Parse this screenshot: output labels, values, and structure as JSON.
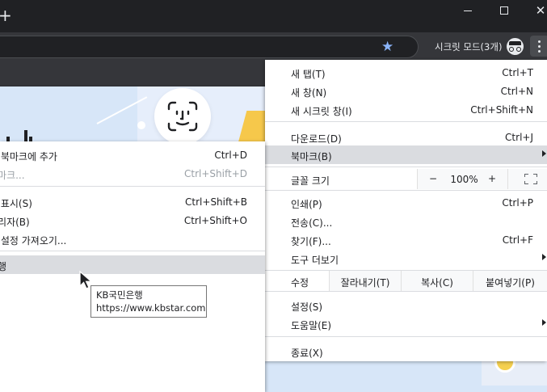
{
  "window": {
    "new_tab": "+",
    "min": "—",
    "max": "☐",
    "close": "✕"
  },
  "toolbar": {
    "incognito_label": "시크릿 모드(3개)",
    "star": "★"
  },
  "menu": {
    "items": [
      {
        "label": "새 탭(T)",
        "shortcut": "Ctrl+T"
      },
      {
        "label": "새 창(N)",
        "shortcut": "Ctrl+N"
      },
      {
        "label": "새 시크릿 창(I)",
        "shortcut": "Ctrl+Shift+N"
      },
      {
        "label": "다운로드(D)",
        "shortcut": "Ctrl+J"
      },
      {
        "label": "북마크(B)",
        "shortcut": ""
      },
      {
        "label": "인쇄(P)",
        "shortcut": "Ctrl+P"
      },
      {
        "label": "전송(C)...",
        "shortcut": ""
      },
      {
        "label": "찾기(F)...",
        "shortcut": "Ctrl+F"
      },
      {
        "label": "도구 더보기",
        "shortcut": ""
      },
      {
        "label": "설정(S)",
        "shortcut": ""
      },
      {
        "label": "도움말(E)",
        "shortcut": ""
      },
      {
        "label": "종료(X)",
        "shortcut": ""
      }
    ],
    "zoom": {
      "label": "글꼴 크기",
      "minus": "−",
      "value": "100%",
      "plus": "+"
    },
    "edit": {
      "label": "수정",
      "cut": "잘라내기(T)",
      "copy": "복사(C)",
      "paste": "붙여넣기(P)"
    }
  },
  "bookmark_submenu": {
    "items": [
      {
        "label": "을 북마크에 추가",
        "shortcut": "Ctrl+D"
      },
      {
        "label": "북마크...",
        "shortcut": "Ctrl+Shift+D"
      },
      {
        "label": "바 표시(S)",
        "shortcut": "Ctrl+Shift+B"
      },
      {
        "label": "관리자(B)",
        "shortcut": "Ctrl+Shift+O"
      },
      {
        "label": "및 설정 가져오기...",
        "shortcut": ""
      },
      {
        "label": "은행",
        "shortcut": ""
      }
    ]
  },
  "tooltip": {
    "line1": "KB국민은행",
    "line2": "https://www.kbstar.com"
  },
  "colors": {
    "titlebar": "#202124",
    "toolbar": "#35363a",
    "menu_highlight": "#dadce0",
    "star": "#8ab4f8",
    "page_bg": "#d7e6f8"
  }
}
